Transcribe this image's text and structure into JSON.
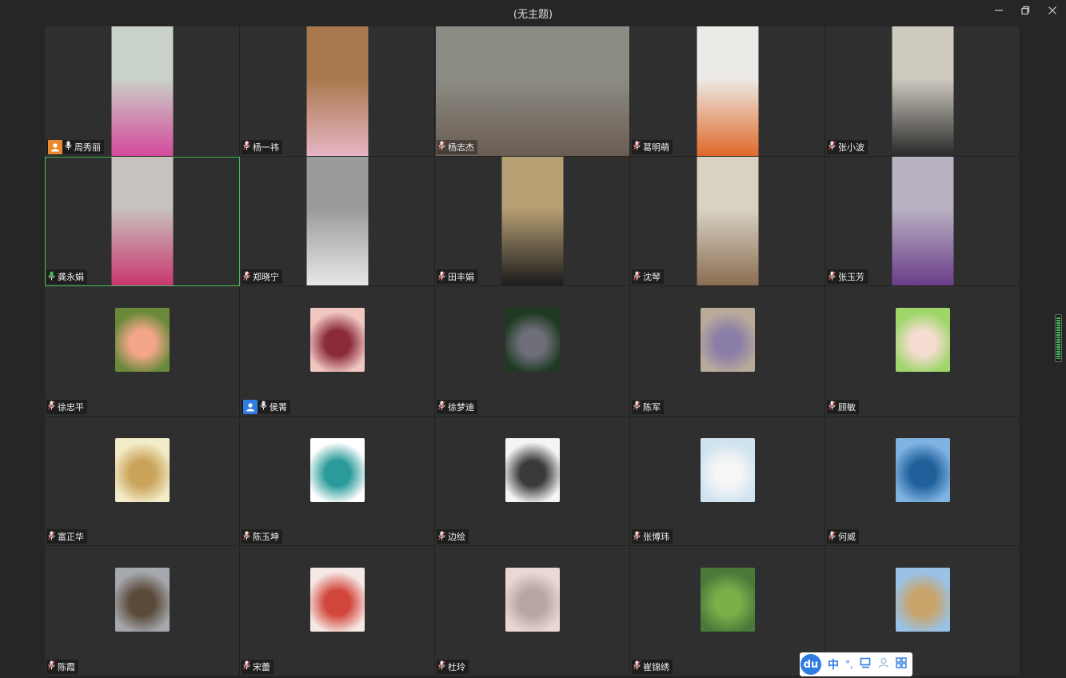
{
  "window": {
    "title": "(无主题)",
    "minimize_icon": "minimize-icon",
    "restore_icon": "restore-icon",
    "close_icon": "close-icon"
  },
  "participants": [
    {
      "name": "周秀丽",
      "kind": "video",
      "host": "orange",
      "scene": [
        "#c9d2c8",
        "#d44a9c"
      ]
    },
    {
      "name": "杨一祎",
      "kind": "video",
      "scene": [
        "#a9784c",
        "#e7b5c4"
      ]
    },
    {
      "name": "杨志杰",
      "kind": "video",
      "wide": true,
      "scene": [
        "#8c8c84",
        "#6a5c52"
      ]
    },
    {
      "name": "葛明萌",
      "kind": "video",
      "scene": [
        "#eceae6",
        "#e0692a"
      ]
    },
    {
      "name": "张小波",
      "kind": "video",
      "scene": [
        "#cfcac0",
        "#2a2a2a"
      ]
    },
    {
      "name": "龚永娟",
      "kind": "video",
      "active": true,
      "scene": [
        "#c7c2bd",
        "#c8376f"
      ]
    },
    {
      "name": "郑晓宁",
      "kind": "video",
      "scene": [
        "#9a9a9a",
        "#e9e8e6"
      ]
    },
    {
      "name": "田丰娟",
      "kind": "video",
      "scene": [
        "#b79f74",
        "#1c1c1c"
      ]
    },
    {
      "name": "沈琴",
      "kind": "video",
      "scene": [
        "#d9d2c3",
        "#8a6e52"
      ]
    },
    {
      "name": "张玉芳",
      "kind": "video",
      "scene": [
        "#b9b2c2",
        "#6a3d8a"
      ]
    },
    {
      "name": "徐忠平",
      "kind": "avatar",
      "scene": [
        "#6a8a3a",
        "#f4a68a"
      ]
    },
    {
      "name": "侯菁",
      "kind": "avatar",
      "host": "blue",
      "scene": [
        "#f1c7c2",
        "#8a2a3a"
      ]
    },
    {
      "name": "徐梦迪",
      "kind": "avatar",
      "scene": [
        "#1e3a22",
        "#6f6f7a"
      ]
    },
    {
      "name": "陈军",
      "kind": "avatar",
      "scene": [
        "#b9ab9a",
        "#8b7ea8"
      ]
    },
    {
      "name": "顾敏",
      "kind": "avatar",
      "scene": [
        "#9ed66a",
        "#f5dcd0"
      ]
    },
    {
      "name": "富正华",
      "kind": "avatar",
      "scene": [
        "#f3ecc8",
        "#c9a45a"
      ]
    },
    {
      "name": "陈玉坤",
      "kind": "avatar",
      "scene": [
        "#ffffff",
        "#2a9a9a"
      ]
    },
    {
      "name": "边绘",
      "kind": "avatar",
      "scene": [
        "#f4f4f4",
        "#3a3a3a"
      ]
    },
    {
      "name": "张博玮",
      "kind": "avatar",
      "scene": [
        "#cfe3ef",
        "#f6f6f6"
      ]
    },
    {
      "name": "何威",
      "kind": "avatar",
      "scene": [
        "#7fb3e2",
        "#1f5f9a"
      ]
    },
    {
      "name": "陈霞",
      "kind": "avatar",
      "scene": [
        "#a5a8ad",
        "#5a4a3a"
      ]
    },
    {
      "name": "宋蕾",
      "kind": "avatar",
      "scene": [
        "#f6e8e4",
        "#d2453a"
      ]
    },
    {
      "name": "杜玲",
      "kind": "avatar",
      "scene": [
        "#ead8d4",
        "#b8a5a2"
      ]
    },
    {
      "name": "崔锦绣",
      "kind": "avatar",
      "scene": [
        "#4a7a3a",
        "#7ab04a"
      ]
    },
    {
      "name": "",
      "kind": "avatar",
      "scene": [
        "#9ac2e6",
        "#c8a46a"
      ]
    }
  ],
  "ime_toolbar": {
    "logo": "du",
    "mode": "中",
    "punct": "°,",
    "items": [
      "punctuation-icon",
      "keyboard-icon",
      "user-icon",
      "grid-icon"
    ]
  },
  "colors": {
    "background": "#262626",
    "tile": "#2f2f2f",
    "active_border": "#3fbf5a",
    "host_orange": "#e98a2f",
    "host_blue": "#2f7de1"
  }
}
